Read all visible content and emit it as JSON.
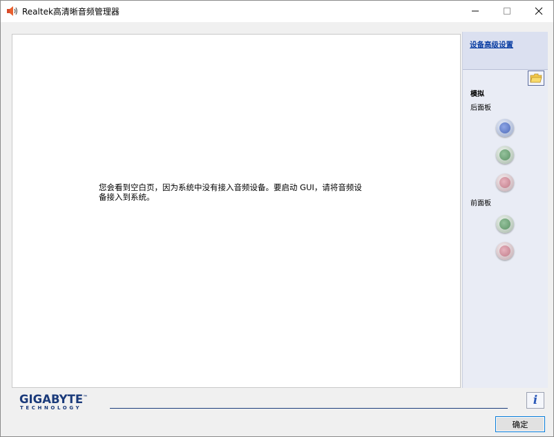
{
  "window": {
    "title": "Realtek高清晰音频管理器",
    "minimize_glyph": "—",
    "maximize_glyph": "☐",
    "close_glyph": "✕"
  },
  "main": {
    "empty_message_line1": "您会看到空白页，因为系统中没有接入音频设备。要启动 GUI，请将音频设",
    "empty_message_line2": "备接入到系统。"
  },
  "sidebar": {
    "advanced_link": "设备高级设置",
    "analog_label": "模拟",
    "rear_panel_label": "后面板",
    "front_panel_label": "前面板",
    "rear_jacks": [
      {
        "color_name": "blue",
        "color": "#4d6ab8"
      },
      {
        "color_name": "green",
        "color": "#5d9266"
      },
      {
        "color_name": "pink",
        "color": "#c07c8a"
      }
    ],
    "front_jacks": [
      {
        "color_name": "green",
        "color": "#5d9266"
      },
      {
        "color_name": "pink",
        "color": "#c07c8a"
      }
    ]
  },
  "footer": {
    "logo_main": "GIGABYTE",
    "logo_tm": "™",
    "logo_sub": "TECHNOLOGY",
    "info_glyph": "i",
    "ok_button": "确定"
  },
  "icons": {
    "app_icon": "speaker-icon",
    "folder": "folder-icon",
    "info": "info-icon"
  },
  "colors": {
    "brand": "#1a3a7a",
    "link": "#0b3ea3",
    "sidebar_bg": "#e9ecf5",
    "focus_border": "#0078d7"
  }
}
